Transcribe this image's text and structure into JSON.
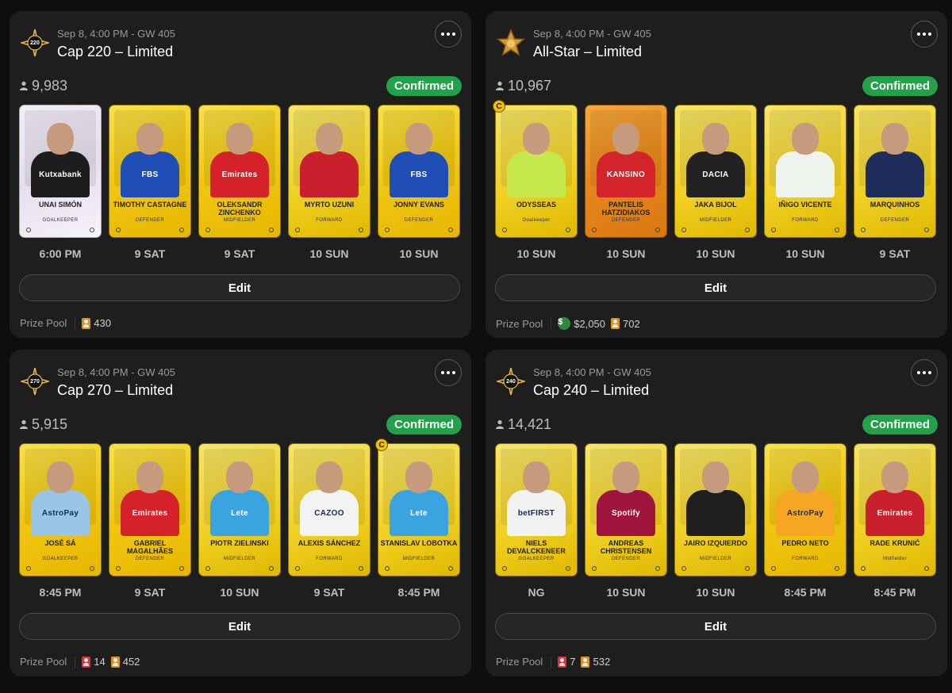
{
  "colors": {
    "confirmed_bg": "#21a248",
    "panel_bg": "#1e1e1f",
    "page_bg": "#0e0e0e"
  },
  "panels": [
    {
      "meta": "Sep 8, 4:00 PM - GW 405",
      "title": "Cap 220 – Limited",
      "badge_label": "220",
      "badge_icon": "star-badge-icon",
      "count": "9,983",
      "status": "Confirmed",
      "edit_label": "Edit",
      "prize_label": "Prize Pool",
      "prizes": [
        {
          "icon": "gold-card-icon",
          "value": "430"
        }
      ],
      "cards": [
        {
          "name": "UNAI SIMÓN",
          "position": "GOALKEEPER",
          "time": "6:00 PM",
          "style": "white",
          "shirt": "#1d1d1d",
          "shirt_text": "Kutxabank"
        },
        {
          "name": "TIMOTHY CASTAGNE",
          "position": "DEFENDER",
          "time": "9 SAT",
          "style": "gold",
          "shirt": "#1f4fb6",
          "shirt_text": "FBS"
        },
        {
          "name": "OLEKSANDR ZINCHENKO",
          "position": "MIDFIELDER",
          "time": "9 SAT",
          "style": "gold",
          "shirt": "#d4212a",
          "shirt_text": "Emirates"
        },
        {
          "name": "MYRTO UZUNI",
          "position": "FORWARD",
          "time": "10 SUN",
          "style": "gold2",
          "shirt": "#c8202c",
          "shirt_text": ""
        },
        {
          "name": "JONNY EVANS",
          "position": "DEFENDER",
          "time": "10 SUN",
          "style": "gold",
          "shirt": "#1f4fb6",
          "shirt_text": "FBS"
        }
      ]
    },
    {
      "meta": "Sep 8, 4:00 PM - GW 405",
      "title": "All-Star – Limited",
      "badge_label": "",
      "badge_icon": "allstar-badge-icon",
      "count": "10,967",
      "status": "Confirmed",
      "edit_label": "Edit",
      "prize_label": "Prize Pool",
      "prizes": [
        {
          "icon": "dollar-icon",
          "value": "$2,050"
        },
        {
          "icon": "gold-card-icon",
          "value": "702"
        }
      ],
      "cards": [
        {
          "name": "Odysseas",
          "position": "Goalkeeper",
          "time": "10 SUN",
          "style": "gold2",
          "shirt": "#c6e84a",
          "shirt_text": "",
          "captain": "C"
        },
        {
          "name": "PANTELIS HATZIDIAKOS",
          "position": "DEFENDER",
          "time": "10 SUN",
          "style": "orange",
          "shirt": "#d3242c",
          "shirt_text": "KANSINO"
        },
        {
          "name": "JAKA BIJOL",
          "position": "MIDFIELDER",
          "time": "10 SUN",
          "style": "gold2",
          "shirt": "#222222",
          "shirt_text": "DACIA"
        },
        {
          "name": "IÑIGO VICENTE",
          "position": "FORWARD",
          "time": "10 SUN",
          "style": "gold2",
          "shirt": "#eef3ee",
          "shirt_text": ""
        },
        {
          "name": "MARQUINHOS",
          "position": "DEFENDER",
          "time": "9 SAT",
          "style": "gold2",
          "shirt": "#1e2d5a",
          "shirt_text": ""
        }
      ]
    },
    {
      "meta": "Sep 8, 4:00 PM - GW 405",
      "title": "Cap 270 – Limited",
      "badge_label": "270",
      "badge_icon": "star-badge-icon",
      "count": "5,915",
      "status": "Confirmed",
      "edit_label": "Edit",
      "prize_label": "Prize Pool",
      "prizes": [
        {
          "icon": "red-card-icon",
          "value": "14"
        },
        {
          "icon": "gold-card-icon",
          "value": "452"
        }
      ],
      "cards": [
        {
          "name": "JOSÉ SÁ",
          "position": "GOALKEEPER",
          "time": "8:45 PM",
          "style": "gold",
          "shirt": "#9ac5e6",
          "shirt_text": "AstroPay"
        },
        {
          "name": "GABRIEL MAGALHÃES",
          "position": "DEFENDER",
          "time": "9 SAT",
          "style": "gold",
          "shirt": "#d4212a",
          "shirt_text": "Emirates"
        },
        {
          "name": "PIOTR ZIELINSKI",
          "position": "MIDFIELDER",
          "time": "10 SUN",
          "style": "gold2",
          "shirt": "#3aa3e0",
          "shirt_text": "Lete"
        },
        {
          "name": "ALEXIS SÁNCHEZ",
          "position": "FORWARD",
          "time": "9 SAT",
          "style": "gold2",
          "shirt": "#f3f3f3",
          "shirt_text": "CAZOO"
        },
        {
          "name": "STANISLAV LOBOTKA",
          "position": "MIDFIELDER",
          "time": "8:45 PM",
          "style": "gold2",
          "shirt": "#3aa3e0",
          "shirt_text": "Lete",
          "captain": "C"
        }
      ]
    },
    {
      "meta": "Sep 8, 4:00 PM - GW 405",
      "title": "Cap 240 – Limited",
      "badge_label": "240",
      "badge_icon": "star-badge-icon",
      "count": "14,421",
      "status": "Confirmed",
      "edit_label": "Edit",
      "prize_label": "Prize Pool",
      "prizes": [
        {
          "icon": "red-card-icon",
          "value": "7"
        },
        {
          "icon": "gold-card-icon",
          "value": "532"
        }
      ],
      "cards": [
        {
          "name": "NIELS DEVALCKENEER",
          "position": "GOALKEEPER",
          "time": "NG",
          "style": "gold2",
          "shirt": "#f2f2f2",
          "shirt_text": "betFIRST"
        },
        {
          "name": "ANDREAS CHRISTENSEN",
          "position": "DEFENDER",
          "time": "10 SUN",
          "style": "gold2",
          "shirt": "#a0153e",
          "shirt_text": "Spotify"
        },
        {
          "name": "JAIRO IZQUIERDO",
          "position": "MIDFIELDER",
          "time": "10 SUN",
          "style": "gold2",
          "shirt": "#1f1f1f",
          "shirt_text": ""
        },
        {
          "name": "PEDRO NETO",
          "position": "FORWARD",
          "time": "8:45 PM",
          "style": "gold",
          "shirt": "#f6a623",
          "shirt_text": "AstroPay"
        },
        {
          "name": "Rade Krunić",
          "position": "Midfielder",
          "time": "8:45 PM",
          "style": "gold2",
          "shirt": "#c8202c",
          "shirt_text": "Emirates"
        }
      ]
    }
  ]
}
